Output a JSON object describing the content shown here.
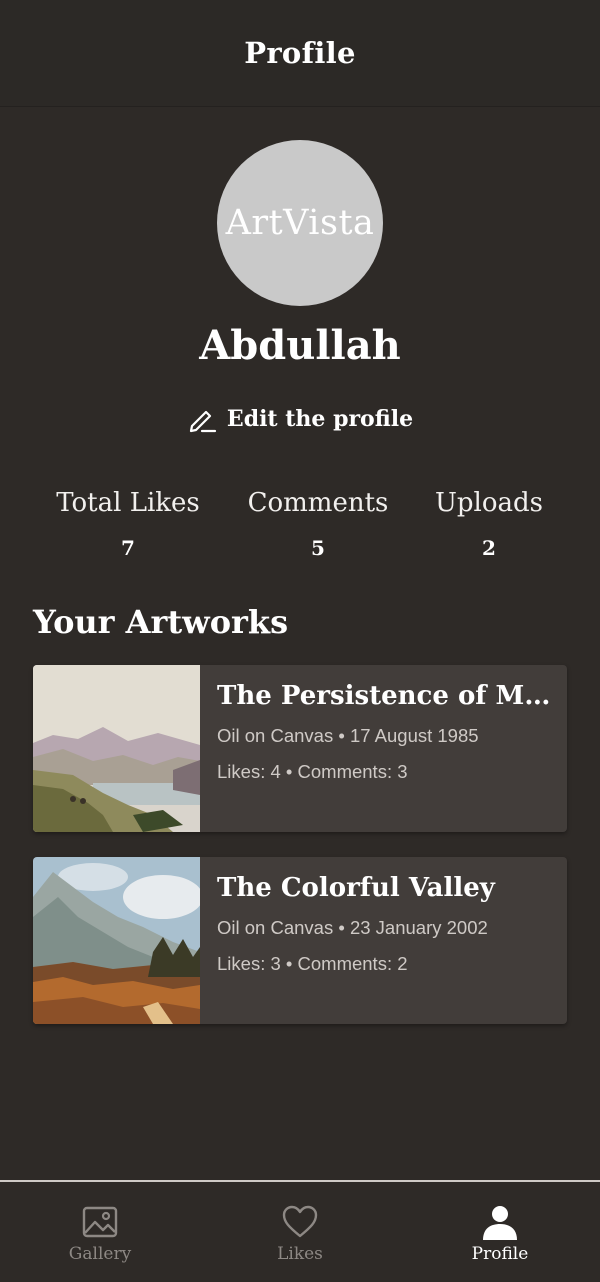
{
  "header": {
    "title": "Profile"
  },
  "profile": {
    "avatar_text": "ArtVista",
    "username": "Abdullah",
    "edit_label": "Edit the profile"
  },
  "stats": [
    {
      "label": "Total Likes",
      "value": "7"
    },
    {
      "label": "Comments",
      "value": "5"
    },
    {
      "label": "Uploads",
      "value": "2"
    }
  ],
  "artworks_section": {
    "title": "Your Artworks",
    "items": [
      {
        "title": "The Persistence of Memory",
        "meta": "Oil on Canvas • 17 August 1985",
        "stats": "Likes: 4 • Comments: 3",
        "thumb_icon": "landscape-lake-painting"
      },
      {
        "title": "The Colorful Valley",
        "meta": "Oil on Canvas • 23 January 2002",
        "stats": "Likes: 3 • Comments: 2",
        "thumb_icon": "landscape-mountain-painting"
      }
    ]
  },
  "bottom_nav": {
    "items": [
      {
        "label": "Gallery",
        "icon": "image-icon",
        "active": false
      },
      {
        "label": "Likes",
        "icon": "heart-icon",
        "active": false
      },
      {
        "label": "Profile",
        "icon": "person-icon",
        "active": true
      }
    ]
  },
  "colors": {
    "background": "#2e2a27",
    "card": "#423d3a",
    "avatar": "#c9c9c9",
    "inactive_nav": "#8d8884"
  }
}
